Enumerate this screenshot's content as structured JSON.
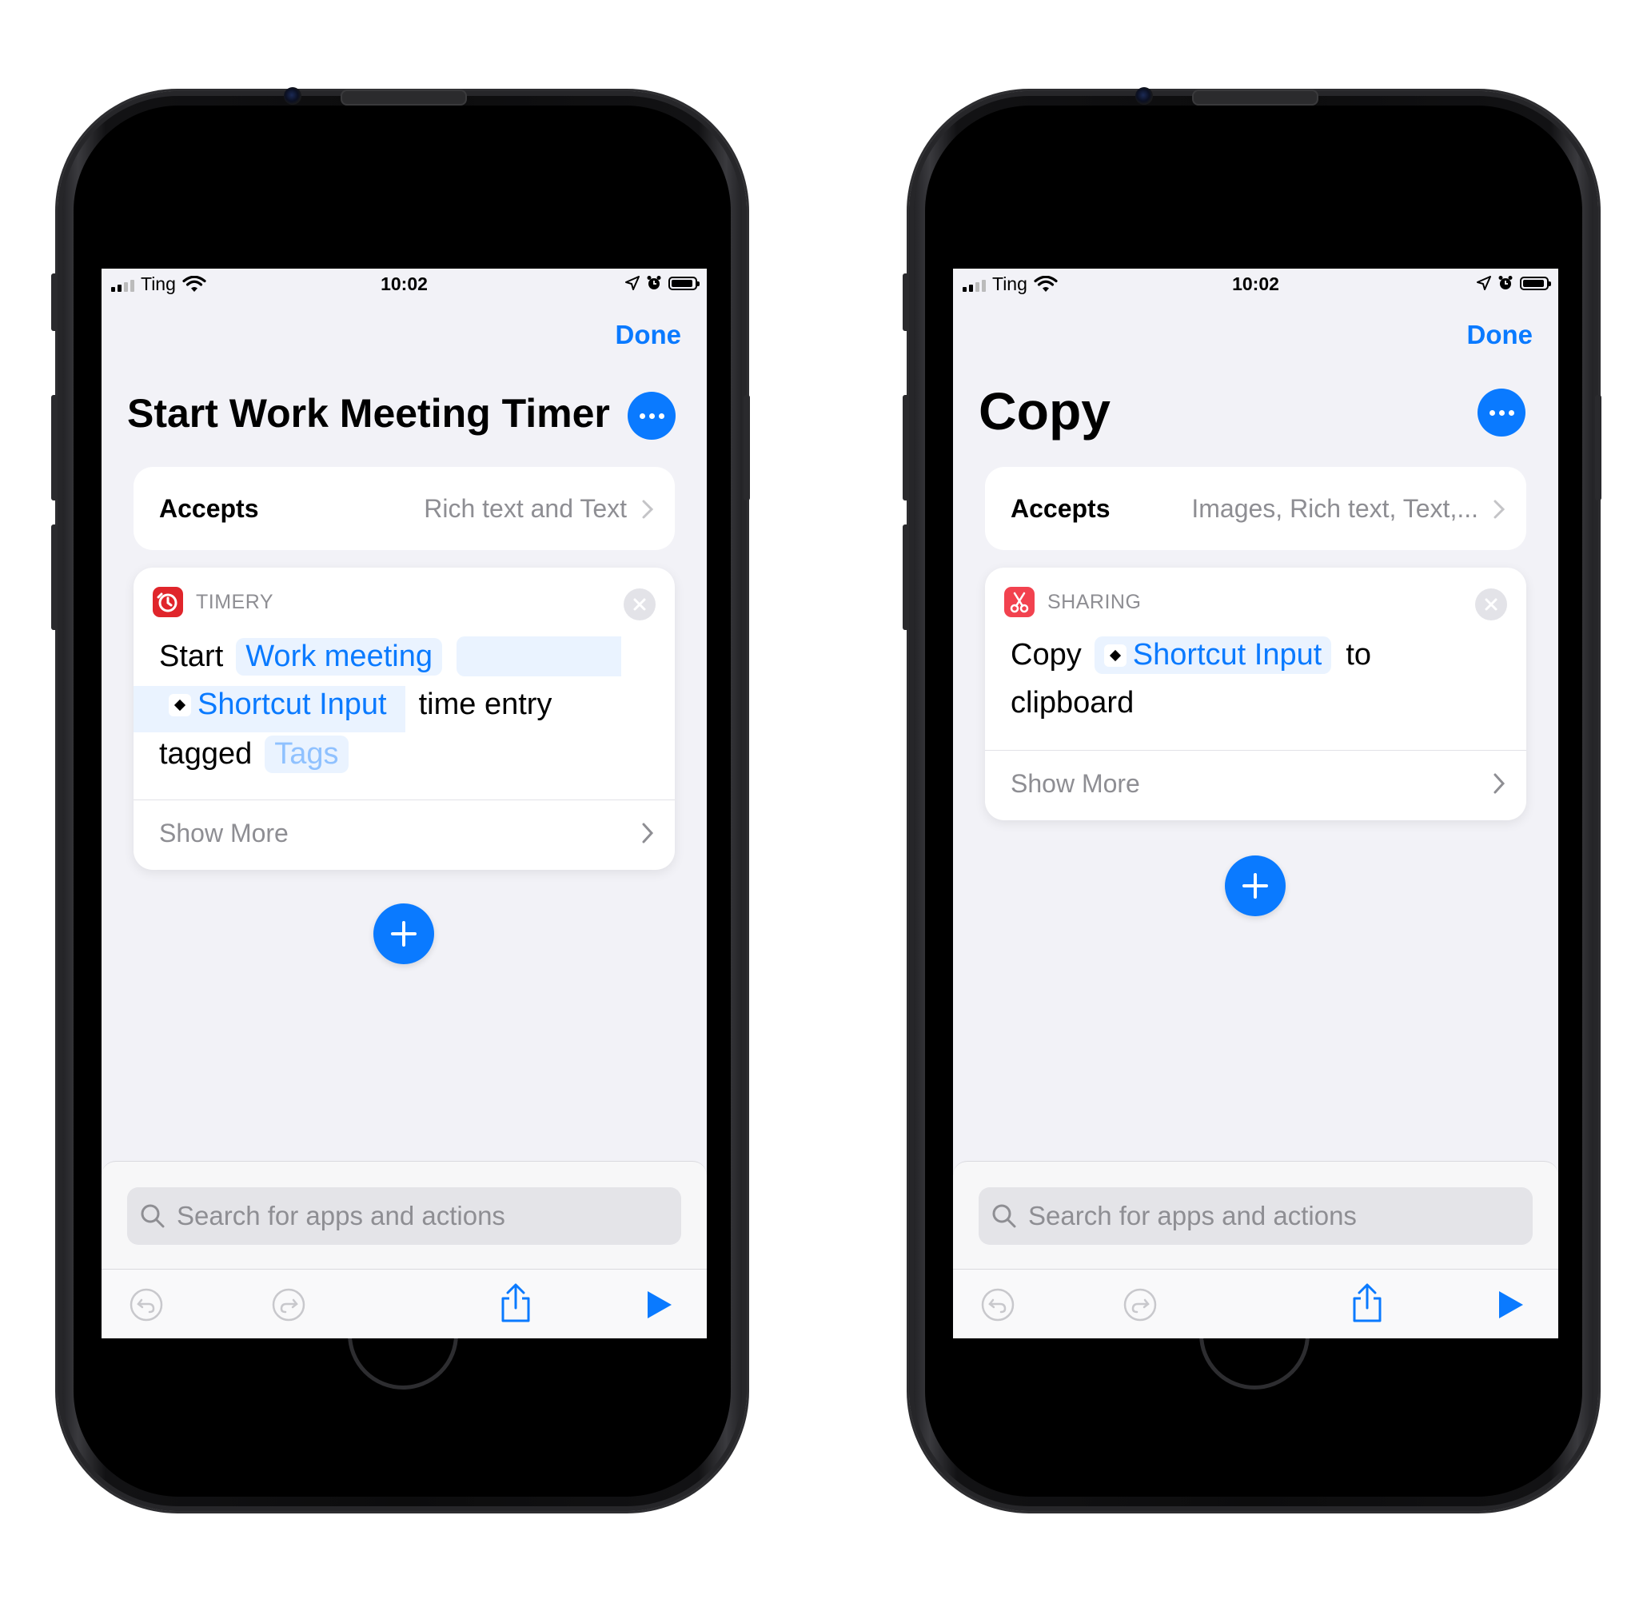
{
  "status_bar": {
    "carrier": "Ting",
    "time": "10:02"
  },
  "common": {
    "done_label": "Done",
    "accepts_label": "Accepts",
    "show_more_label": "Show More",
    "search_placeholder": "Search for apps and actions"
  },
  "left_phone": {
    "title": "Start Work Meeting Timer",
    "accepts_value": "Rich text and Text",
    "action": {
      "app_name": "TIMERY",
      "app_color": "#e0252b",
      "word_start": "Start",
      "token_work_meeting": "Work meeting",
      "token_shortcut_input": "Shortcut Input",
      "word_time_entry": "time entry",
      "word_tagged": "tagged",
      "token_tags": "Tags"
    }
  },
  "right_phone": {
    "title": "Copy",
    "accepts_value": "Images, Rich text, Text,...",
    "action": {
      "app_name": "SHARING",
      "app_color": "#f2424f",
      "word_copy": "Copy",
      "token_shortcut_input": "Shortcut Input",
      "word_to": "to",
      "word_clipboard": "clipboard"
    }
  },
  "colors": {
    "accent": "#0a7aff",
    "screen_bg": "#f2f2f7"
  }
}
